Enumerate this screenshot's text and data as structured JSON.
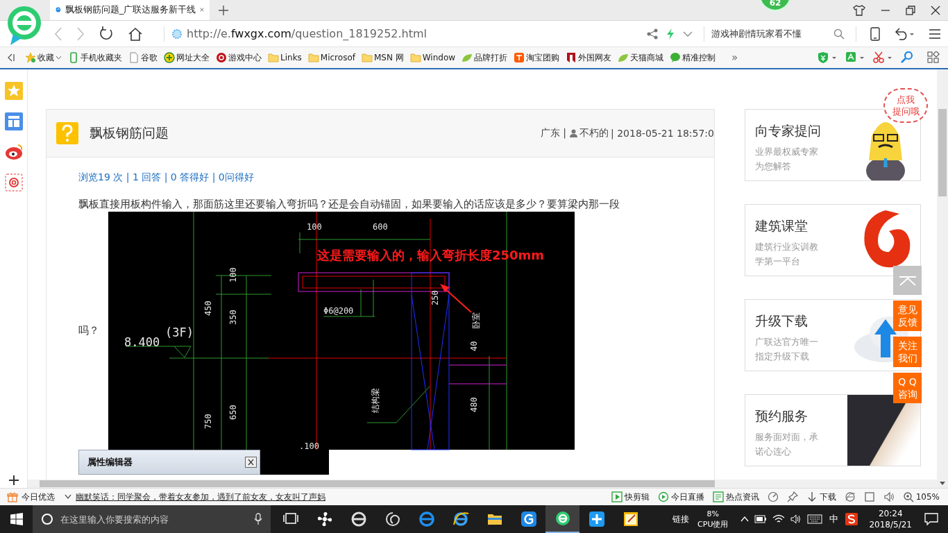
{
  "browser": {
    "tab_title": "飘板钢筋问题_广联达服务新干线",
    "badge": "62",
    "url": {
      "scheme": "http://e.",
      "domain": "fwxgx.com",
      "path": "/question_1819252.html"
    },
    "search_text": "游戏神剧情玩家看不懂"
  },
  "bookmarks": [
    {
      "label": "收藏",
      "kind": "star"
    },
    {
      "label": "手机收藏夹",
      "kind": "phone"
    },
    {
      "label": "谷歌",
      "kind": "page"
    },
    {
      "label": "网址大全",
      "kind": "globe"
    },
    {
      "label": "游戏中心",
      "kind": "game"
    },
    {
      "label": "Links",
      "kind": "folder"
    },
    {
      "label": "Microsof",
      "kind": "folder"
    },
    {
      "label": "MSN 网",
      "kind": "folder"
    },
    {
      "label": "Window",
      "kind": "folder"
    },
    {
      "label": "品牌打折",
      "kind": "leaf"
    },
    {
      "label": "淘宝团购",
      "kind": "tao"
    },
    {
      "label": "外国网友",
      "kind": "flag"
    },
    {
      "label": "天猫商城",
      "kind": "leaf"
    },
    {
      "label": "精准控制",
      "kind": "chat"
    }
  ],
  "bookmarks_more": "»",
  "question": {
    "title": "飘板钢筋问题",
    "region": "广东 |",
    "author": "不朽的",
    "date": "| 2018-05-21 18:57:0",
    "stats": "浏览19 次 | 1 回答 | 0 答得好 | 0问得好",
    "text": "飘板直接用板构件输入，那面筋这里还要输入弯折吗？还是会自动锚固，如果要输入的话应该是多少？要算梁内那一段",
    "text_tail": "吗？"
  },
  "cad": {
    "labels": [
      "100",
      "600",
      "100",
      "450",
      "350",
      "Φ6@200",
      "250",
      "卧室",
      "8.400",
      "(3F)",
      "40",
      "结构梁",
      "750",
      "650",
      "480",
      ".100"
    ],
    "annotation": "这是需要输入的，输入弯折长度250mm",
    "panel_title": "属性编辑器"
  },
  "side_cards": [
    {
      "title": "向专家提问",
      "lines": [
        "业界最权威专家",
        "为您解答"
      ],
      "kind": "mascot"
    },
    {
      "title": "建筑课堂",
      "lines": [
        "建筑行业实训教",
        "学第一平台"
      ],
      "kind": "logo"
    },
    {
      "title": "升级下载",
      "lines": [
        "广联达官方唯一",
        "指定升级下载"
      ],
      "kind": "cloud"
    },
    {
      "title": "预约服务",
      "lines": [
        "服务面对面，承",
        "诺心连心"
      ],
      "kind": "photo"
    }
  ],
  "ask_bubble": [
    "点我",
    "提问哦"
  ],
  "float_buttons": [
    {
      "kind": "top"
    },
    {
      "kind": "text",
      "lines": [
        "意见",
        "反馈"
      ]
    },
    {
      "kind": "text",
      "lines": [
        "关注",
        "我们"
      ]
    },
    {
      "kind": "text",
      "lines": [
        "Q Q",
        "咨询"
      ]
    }
  ],
  "news_bar": {
    "label": "今日优选",
    "headline": "幽默笑话：同学聚会，带着女友参加，遇到了前女友，女友叫了声妈",
    "tools": [
      {
        "label": "快剪辑",
        "kind": "clip"
      },
      {
        "label": "今日直播",
        "kind": "live"
      },
      {
        "label": "热点资讯",
        "kind": "news"
      },
      {
        "kind": "speed"
      },
      {
        "kind": "pin"
      },
      {
        "label": "下载",
        "kind": "download"
      },
      {
        "kind": "ie"
      },
      {
        "kind": "window"
      },
      {
        "kind": "sound"
      },
      {
        "label": "105%",
        "kind": "zoom"
      }
    ]
  },
  "taskbar": {
    "search_placeholder": "在这里输入你要搜索的内容",
    "apps": [
      {
        "kind": "taskview",
        "selected": false
      },
      {
        "kind": "fan",
        "selected": false
      },
      {
        "kind": "ie-grey",
        "selected": false
      },
      {
        "kind": "swirl",
        "selected": false
      },
      {
        "kind": "edge",
        "selected": false
      },
      {
        "kind": "ie",
        "selected": false
      },
      {
        "kind": "folder",
        "selected": false
      },
      {
        "kind": "gapp",
        "selected": false
      },
      {
        "kind": "browser",
        "selected": true
      },
      {
        "kind": "plus",
        "selected": false
      },
      {
        "kind": "notes",
        "selected": false
      }
    ],
    "links": "链接",
    "cpu": {
      "value": "8%",
      "label": "CPU使用"
    },
    "ime": "中",
    "time": "20:24",
    "date": "2018/5/21"
  }
}
